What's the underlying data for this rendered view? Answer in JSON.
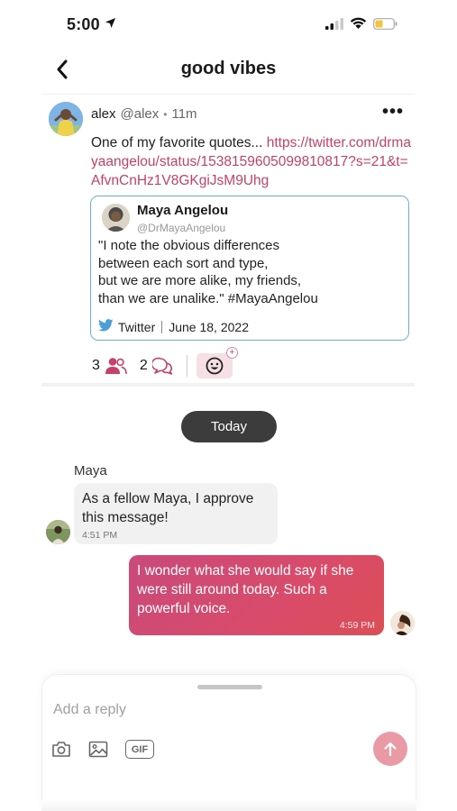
{
  "status_bar": {
    "time": "5:00"
  },
  "nav": {
    "title": "good vibes"
  },
  "post": {
    "author": "alex",
    "handle": "@alex",
    "separator": "•",
    "time": "11m",
    "more": "•••",
    "text": "One of my favorite quotes... ",
    "link": "https://twitter.com/drmayaangelou/status/1538159605099810817?s=21&t=AfvnCnHz1V8GKgiJsM9Uhg",
    "quote": {
      "name": "Maya Angelou",
      "handle": "@DrMayaAngelou",
      "text": "\"I note the obvious differences\nbetween each sort and type,\nbut we are more alike, my friends,\nthan we are unalike.\" #MayaAngelou",
      "source": "Twitter",
      "date": "June 18, 2022"
    },
    "stats": {
      "members": "3",
      "replies": "2"
    }
  },
  "chat": {
    "date_separator": "Today",
    "messages": [
      {
        "sender": "Maya",
        "text": "As a fellow Maya, I approve this message!",
        "time": "4:51 PM",
        "outgoing": false
      },
      {
        "sender": "",
        "text": "I wonder what she would say if she were still around today. Such a powerful voice.",
        "time": "4:59 PM",
        "outgoing": true
      }
    ]
  },
  "composer": {
    "placeholder": "Add a reply",
    "gif_label": "GIF"
  },
  "colors": {
    "accent": "#c8406a",
    "link_blue": "#6bb0e0",
    "send_button": "#e99aa5",
    "date_pill": "#3c3c3c"
  },
  "icons": [
    "location-arrow-icon",
    "signal-icon",
    "wifi-icon",
    "battery-icon",
    "back-icon",
    "more-icon",
    "twitter-icon",
    "people-icon",
    "replies-icon",
    "emoji-icon",
    "camera-icon",
    "image-icon",
    "gif-icon",
    "send-icon"
  ]
}
